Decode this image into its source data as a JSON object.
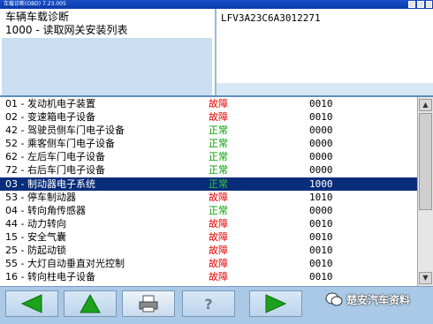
{
  "window": {
    "title": "车载诊断(OBD) 7.23.005"
  },
  "header": {
    "title": "车辆车载诊断",
    "subtitle": "1000 - 读取网关安装列表",
    "vin": "LFV3A23C6A3012271"
  },
  "modules": [
    {
      "name": "01 - 发动机电子装置",
      "status": "故障",
      "code": "0010",
      "state": "fault"
    },
    {
      "name": "02 - 变速箱电子设备",
      "status": "故障",
      "code": "0010",
      "state": "fault"
    },
    {
      "name": "42 - 驾驶员侧车门电子设备",
      "status": "正常",
      "code": "0000",
      "state": "ok"
    },
    {
      "name": "52 - 乘客侧车门电子设备",
      "status": "正常",
      "code": "0000",
      "state": "ok"
    },
    {
      "name": "62 - 左后车门电子设备",
      "status": "正常",
      "code": "0000",
      "state": "ok"
    },
    {
      "name": "72 - 右后车门电子设备",
      "status": "正常",
      "code": "0000",
      "state": "ok"
    },
    {
      "name": "03 - 制动器电子系统",
      "status": "正常",
      "code": "1000",
      "state": "ok",
      "selected": true
    },
    {
      "name": "53 - 停车制动器",
      "status": "故障",
      "code": "1010",
      "state": "fault"
    },
    {
      "name": "04 - 转向角传感器",
      "status": "正常",
      "code": "0000",
      "state": "ok"
    },
    {
      "name": "44 - 动力转向",
      "status": "故障",
      "code": "0010",
      "state": "fault"
    },
    {
      "name": "15 - 安全气囊",
      "status": "故障",
      "code": "0010",
      "state": "fault"
    },
    {
      "name": "25 - 防起动锁",
      "status": "故障",
      "code": "0010",
      "state": "fault"
    },
    {
      "name": "55 - 大灯自动垂直对光控制",
      "status": "故障",
      "code": "0010",
      "state": "fault"
    },
    {
      "name": "16 - 转向柱电子设备",
      "status": "故障",
      "code": "0010",
      "state": "fault"
    }
  ],
  "toolbar": {
    "buttons": [
      {
        "name": "back-button",
        "icon": "arrow-left-icon"
      },
      {
        "name": "up-button",
        "icon": "arrow-up-icon"
      },
      {
        "name": "print-button",
        "icon": "printer-icon"
      },
      {
        "name": "help-button",
        "icon": "help-icon"
      },
      {
        "name": "forward-button",
        "icon": "arrow-right-icon"
      }
    ]
  },
  "watermark": {
    "text": "楚安汽车资料"
  },
  "colors": {
    "fault": "#e00000",
    "ok": "#00a000",
    "selected_row": "#0a2d7a",
    "toolbar_bg": "#a9c9e6",
    "arrow_green": "#1ca21c"
  }
}
